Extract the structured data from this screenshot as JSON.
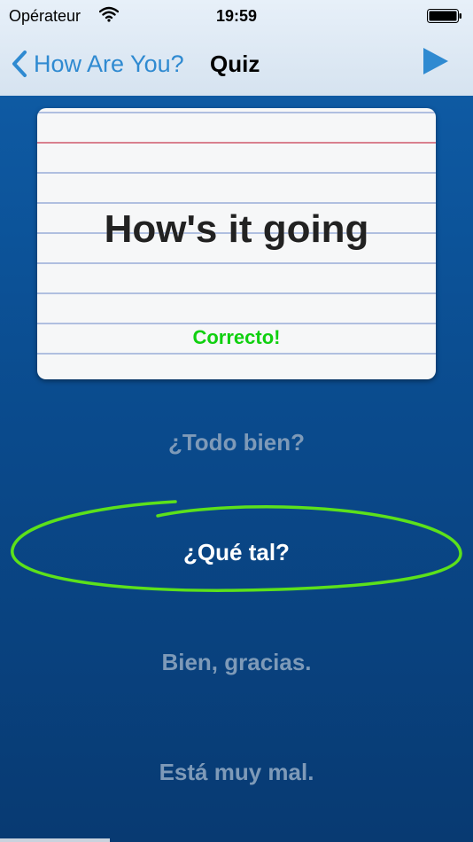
{
  "status": {
    "carrier": "Opérateur",
    "time": "19:59"
  },
  "nav": {
    "back_label": "How Are You?",
    "title": "Quiz"
  },
  "card": {
    "prompt": "How's it going",
    "feedback": "Correcto!"
  },
  "answers": [
    {
      "text": "¿Todo bien?"
    },
    {
      "text": "¿Qué tal?"
    },
    {
      "text": "Bien, gracias."
    },
    {
      "text": "Está muy mal."
    }
  ],
  "colors": {
    "accent": "#2f8ad1",
    "correct": "#10d010",
    "answer_dim": "#7e9ab8",
    "circle": "#5ce11b"
  },
  "icons": [
    "wifi-icon",
    "battery-icon",
    "chevron-left-icon",
    "play-icon"
  ]
}
